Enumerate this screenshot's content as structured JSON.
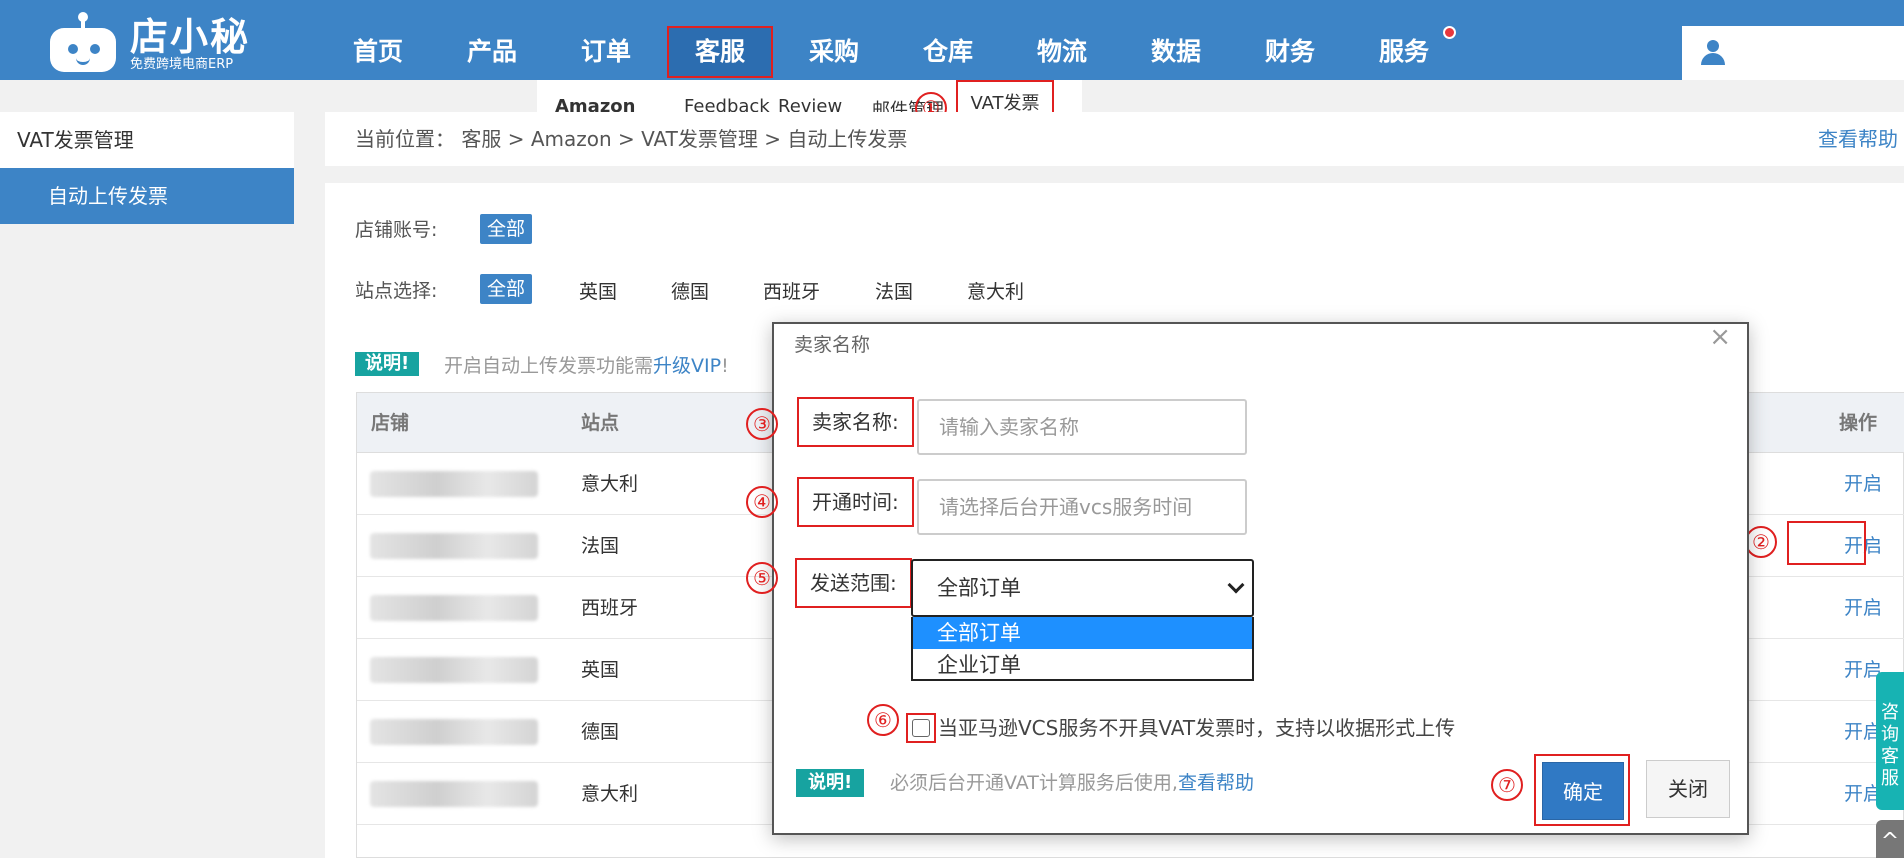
{
  "logo": {
    "name": "店小秘",
    "subtitle": "免费跨境电商ERP"
  },
  "nav": {
    "items": [
      "首页",
      "产品",
      "订单",
      "客服",
      "采购",
      "仓库",
      "物流",
      "数据",
      "财务",
      "服务"
    ],
    "active": "客服"
  },
  "submenu": {
    "amazon": "Amazon",
    "feedback": "Feedback",
    "review": "Review",
    "mail": "邮件管理",
    "vat": "VAT发票"
  },
  "annotations": [
    "①",
    "②",
    "③",
    "④",
    "⑤",
    "⑥",
    "⑦"
  ],
  "sidebar": {
    "header": "VAT发票管理",
    "items": [
      "自动上传发票"
    ]
  },
  "breadcrumb": {
    "text": "当前位置：  客服 > Amazon > VAT发票管理 > 自动上传发票",
    "help": "查看帮助"
  },
  "filters": {
    "shop_label": "店铺账号:",
    "shop_selected": "全部",
    "site_label": "站点选择:",
    "site_selected": "全部",
    "sites": [
      "英国",
      "德国",
      "西班牙",
      "法国",
      "意大利"
    ]
  },
  "notice": {
    "badge": "说明!",
    "text": "开启自动上传发票功能需",
    "link": "升级VIP",
    "suffix": "!"
  },
  "table": {
    "headers": {
      "shop": "店铺",
      "site": "站点",
      "op": "操作"
    },
    "rows": [
      {
        "site": "意大利",
        "op": "开启"
      },
      {
        "site": "法国",
        "op": "开启"
      },
      {
        "site": "西班牙",
        "op": "开启"
      },
      {
        "site": "英国",
        "op": "开启"
      },
      {
        "site": "德国",
        "op": "开启"
      },
      {
        "site": "意大利",
        "op": "开启"
      }
    ]
  },
  "modal": {
    "title": "卖家名称",
    "close_symbol": "×",
    "seller_label": "卖家名称:",
    "seller_placeholder": "请输入卖家名称",
    "time_label": "开通时间:",
    "time_placeholder": "请选择后台开通vcs服务时间",
    "scope_label": "发送范围:",
    "scope_selected": "全部订单",
    "scope_options": [
      "全部订单",
      "企业订单"
    ],
    "checkbox_text": "当亚马逊VCS服务不开具VAT发票时，支持以收据形式上传",
    "note_badge": "说明!",
    "note_text": "必须后台开通VAT计算服务后使用,",
    "note_link": "查看帮助",
    "ok": "确定",
    "cancel": "关闭"
  },
  "float": {
    "consult": "咨询客服",
    "top": "^"
  }
}
